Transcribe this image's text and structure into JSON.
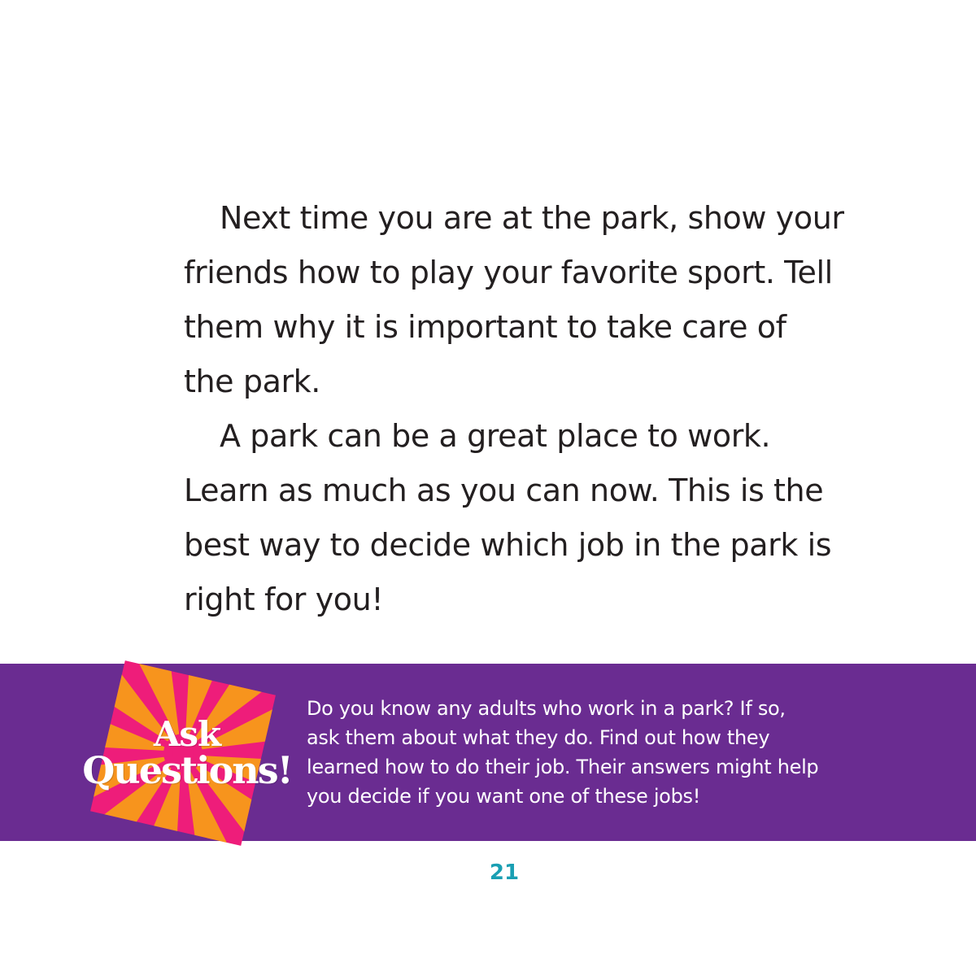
{
  "body": {
    "paragraph1": [
      "Next time you are at the park, show your",
      "friends how to play your favorite sport. Tell",
      "them why it is important to take care of",
      "the park."
    ],
    "paragraph2": [
      "A park can be a great place to work.",
      "Learn as much as you can now. This is the",
      "best way to decide which job in the park is",
      "right for you!"
    ]
  },
  "sidebar": {
    "badge": {
      "line1": "Ask",
      "line2": "Questions!"
    },
    "text": [
      "Do you know any adults who work in a park? If so,",
      "ask them about what they do. Find out how they",
      "learned how to do their job. Their answers might help",
      "you decide if you want one of these jobs!"
    ]
  },
  "page_number": "21",
  "colors": {
    "banner": "#6a2c91",
    "badge_background": "#ee1d7a",
    "badge_rays": "#f7941d",
    "page_number": "#1a9fb3",
    "text": "#231f20"
  }
}
